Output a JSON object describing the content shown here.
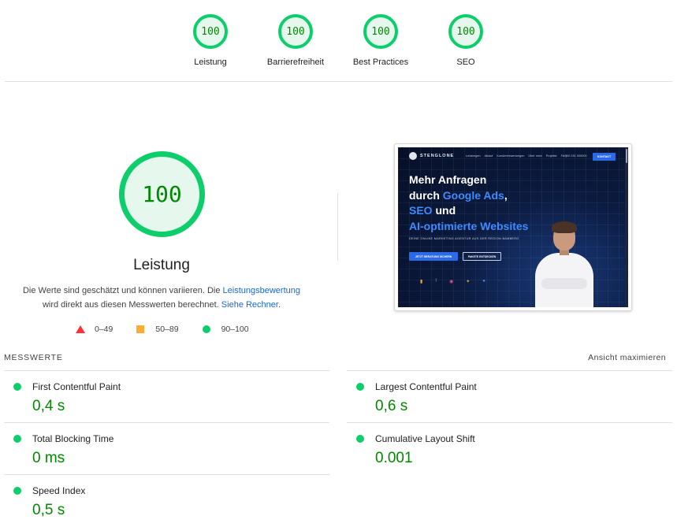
{
  "top_gauges": [
    {
      "score": "100",
      "label": "Leistung"
    },
    {
      "score": "100",
      "label": "Barrierefreiheit"
    },
    {
      "score": "100",
      "label": "Best Practices"
    },
    {
      "score": "100",
      "label": "SEO"
    }
  ],
  "main": {
    "score": "100",
    "title": "Leistung",
    "desc_part1": "Die Werte sind geschätzt und können variieren. Die ",
    "desc_link1": "Leistungsbewertung",
    "desc_part2": "wird direkt aus diesen Messwerten berechnet. ",
    "desc_link2": "Siehe Rechner",
    "desc_end": "."
  },
  "legend": {
    "fail": "0–49",
    "average": "50–89",
    "pass": "90–100"
  },
  "thumbnail": {
    "brand": "STENGLONE",
    "menu": [
      "Leistungen",
      "Ablauf",
      "Kundenbewertungen",
      "Über mich",
      "Projekte",
      "FAQ"
    ],
    "phone": "+49 151 000000",
    "contact": "KONTAKT",
    "headline_line1": "Mehr Anfragen",
    "headline_line2_a": "durch ",
    "headline_line2_b": "Google Ads",
    "headline_line2_c": ",",
    "headline_line3_a": "SEO",
    "headline_line3_b": " und",
    "headline_line4": "AI-optimierte Websites",
    "sub": "DEINE ONLINE MARKETING AGENTUR AUS DER REGION BAMBERG",
    "btn_primary": "JETZT BERATUNG SICHERN",
    "btn_secondary": "PAKETE ENTDECKEN",
    "icons": [
      "ads-icon",
      "facebook-icon",
      "instagram-icon",
      "google-icon",
      "meta-icon",
      "more-icon"
    ]
  },
  "metrics": {
    "heading": "MESSWERTE",
    "toggle": "Ansicht maximieren",
    "items": [
      {
        "title": "First Contentful Paint",
        "value": "0,4 s"
      },
      {
        "title": "Largest Contentful Paint",
        "value": "0,6 s"
      },
      {
        "title": "Total Blocking Time",
        "value": "0 ms"
      },
      {
        "title": "Cumulative Layout Shift",
        "value": "0.001"
      },
      {
        "title": "Speed Index",
        "value": "0,5 s"
      }
    ]
  },
  "colors": {
    "pass": "#0cce6b",
    "pass_text": "#008800",
    "average": "#ffaa33",
    "fail": "#ff3333",
    "link": "#1967d2"
  }
}
